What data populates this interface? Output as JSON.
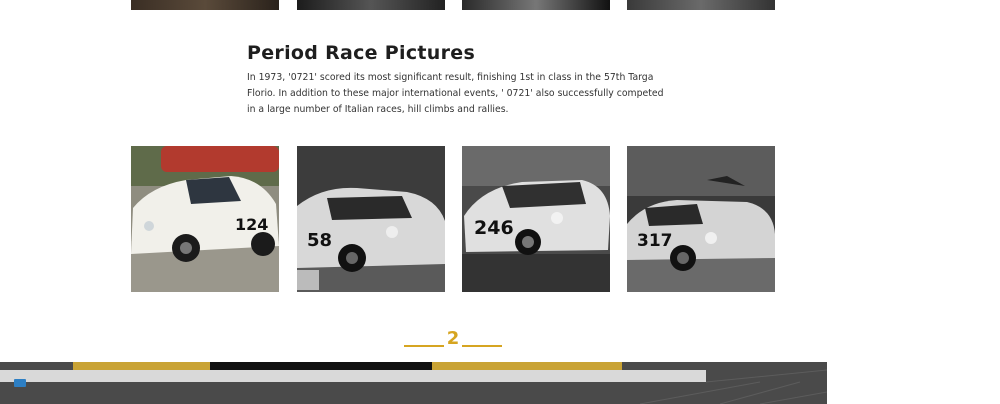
{
  "section": {
    "title": "Period Race Pictures",
    "body": "In 1973, '0721' scored its most significant result, finishing 1st in class in the 57th Targa Florio. In addition to these major international events, ' 0721' also successfully competed in a large number of Italian races, hill climbs and rallies."
  },
  "photos": [
    {
      "number": "124"
    },
    {
      "number": "58"
    },
    {
      "number": "246"
    },
    {
      "number": "317"
    }
  ],
  "pagination": {
    "current": "2"
  },
  "colors": {
    "accent": "#d6a521",
    "heading": "#1e1e1e",
    "footer_bg": "#4a4a4a"
  }
}
